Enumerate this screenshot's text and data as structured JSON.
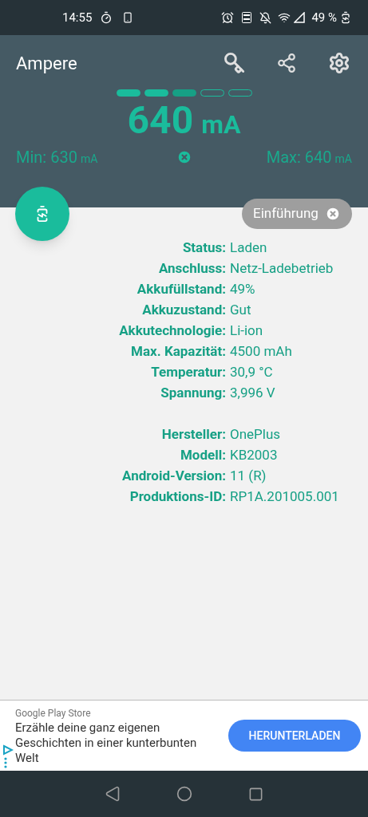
{
  "status_bar": {
    "time": "14:55",
    "battery": "49 %"
  },
  "app_bar": {
    "title": "Ampere"
  },
  "meter": {
    "segments": [
      {
        "kind": "full"
      },
      {
        "kind": "full"
      },
      {
        "kind": "partial"
      },
      {
        "kind": "empty"
      },
      {
        "kind": "empty"
      }
    ],
    "value": "640",
    "unit": "mA",
    "min_label": "Min: 630",
    "min_unit": "mA",
    "max_label": "Max: 640",
    "max_unit": "mA"
  },
  "intro_chip": {
    "label": "Einführung"
  },
  "info_groups": [
    [
      {
        "label": "Status:",
        "value": "Laden"
      },
      {
        "label": "Anschluss:",
        "value": "Netz-Ladebetrieb"
      },
      {
        "label": "Akkufüllstand:",
        "value": "49%"
      },
      {
        "label": "Akkuzustand:",
        "value": "Gut"
      },
      {
        "label": "Akkutechnologie:",
        "value": "Li-ion"
      },
      {
        "label": "Max. Kapazität:",
        "value": "4500 mAh"
      },
      {
        "label": "Temperatur:",
        "value": "30,9 °C"
      },
      {
        "label": "Spannung:",
        "value": "3,996 V"
      }
    ],
    [
      {
        "label": "Hersteller:",
        "value": "OnePlus"
      },
      {
        "label": "Modell:",
        "value": "KB2003"
      },
      {
        "label": "Android-Version:",
        "value": "11 (R)"
      },
      {
        "label": "Produktions-ID:",
        "value": "RP1A.201005.001"
      }
    ]
  ],
  "ad": {
    "source": "Google Play Store",
    "text": "Erzähle deine ganz eigenen Geschichten in einer kunterbunten Welt",
    "button": "HERUNTERLADEN"
  }
}
